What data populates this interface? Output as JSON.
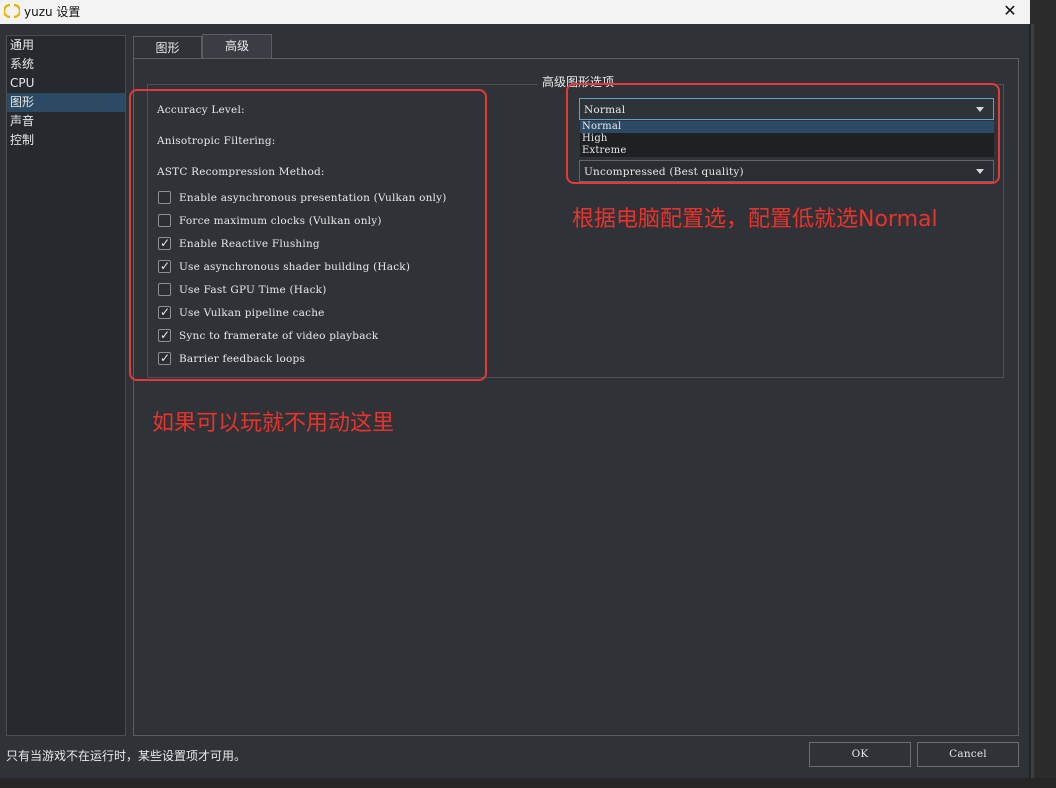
{
  "window": {
    "title": "yuzu 设置"
  },
  "sidebar": {
    "items": [
      {
        "label": "通用"
      },
      {
        "label": "系统"
      },
      {
        "label": "CPU"
      },
      {
        "label": "图形"
      },
      {
        "label": "声音"
      },
      {
        "label": "控制"
      }
    ],
    "active_index": 3
  },
  "tabs": [
    {
      "label": "图形"
    },
    {
      "label": "高级"
    }
  ],
  "active_tab": 1,
  "group": {
    "title": "高级图形选项",
    "fields": {
      "accuracy": "Accuracy Level:",
      "anisotropic": "Anisotropic Filtering:",
      "astc": "ASTC Recompression Method:"
    },
    "accuracy_combo": {
      "value": "Normal",
      "options": [
        "Normal",
        "High",
        "Extreme"
      ]
    },
    "astc_combo": {
      "value": "Uncompressed (Best quality)"
    },
    "checkboxes": [
      {
        "label": "Enable asynchronous presentation (Vulkan only)",
        "checked": false
      },
      {
        "label": "Force maximum clocks (Vulkan only)",
        "checked": false
      },
      {
        "label": "Enable Reactive Flushing",
        "checked": true
      },
      {
        "label": "Use asynchronous shader building (Hack)",
        "checked": true
      },
      {
        "label": "Use Fast GPU Time (Hack)",
        "checked": false
      },
      {
        "label": "Use Vulkan pipeline cache",
        "checked": true
      },
      {
        "label": "Sync to framerate of video playback",
        "checked": true
      },
      {
        "label": "Barrier feedback loops",
        "checked": true
      }
    ]
  },
  "annotations": {
    "right_note": "根据电脑配置选，配置低就选Normal",
    "left_note": "如果可以玩就不用动这里",
    "color": "#e23a3a"
  },
  "footer": {
    "note": "只有当游戏不在运行时，某些设置项才可用。",
    "ok": "OK",
    "cancel": "Cancel"
  },
  "icons": {
    "close": "close-icon",
    "app": "yuzu-logo-icon",
    "check": "check-icon",
    "dropdown": "chevron-down-icon"
  }
}
